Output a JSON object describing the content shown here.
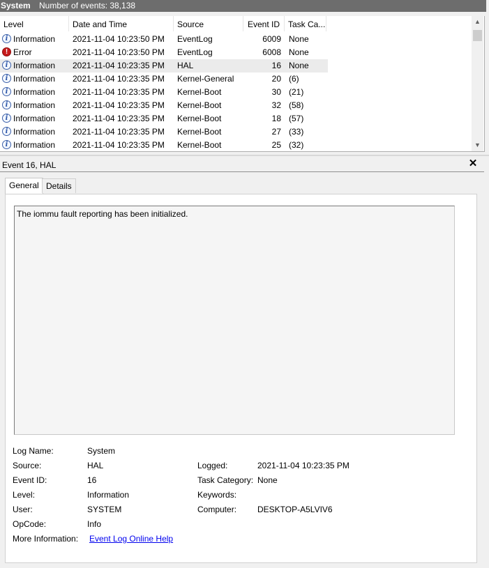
{
  "title_bar": {
    "log": "System",
    "events": "Number of events: 38,138"
  },
  "columns": [
    "Level",
    "Date and Time",
    "Source",
    "Event ID",
    "Task Ca..."
  ],
  "events": [
    {
      "level": "Information",
      "icon": "info-icon",
      "date": "2021-11-04 10:23:50 PM",
      "source": "EventLog",
      "id": "6009",
      "task": "None"
    },
    {
      "level": "Error",
      "icon": "error-icon",
      "date": "2021-11-04 10:23:50 PM",
      "source": "EventLog",
      "id": "6008",
      "task": "None"
    },
    {
      "level": "Information",
      "icon": "info-icon",
      "date": "2021-11-04 10:23:35 PM",
      "source": "HAL",
      "id": "16",
      "task": "None"
    },
    {
      "level": "Information",
      "icon": "info-icon",
      "date": "2021-11-04 10:23:35 PM",
      "source": "Kernel-General",
      "id": "20",
      "task": "(6)"
    },
    {
      "level": "Information",
      "icon": "info-icon",
      "date": "2021-11-04 10:23:35 PM",
      "source": "Kernel-Boot",
      "id": "30",
      "task": "(21)"
    },
    {
      "level": "Information",
      "icon": "info-icon",
      "date": "2021-11-04 10:23:35 PM",
      "source": "Kernel-Boot",
      "id": "32",
      "task": "(58)"
    },
    {
      "level": "Information",
      "icon": "info-icon",
      "date": "2021-11-04 10:23:35 PM",
      "source": "Kernel-Boot",
      "id": "18",
      "task": "(57)"
    },
    {
      "level": "Information",
      "icon": "info-icon",
      "date": "2021-11-04 10:23:35 PM",
      "source": "Kernel-Boot",
      "id": "27",
      "task": "(33)"
    },
    {
      "level": "Information",
      "icon": "info-icon",
      "date": "2021-11-04 10:23:35 PM",
      "source": "Kernel-Boot",
      "id": "25",
      "task": "(32)"
    }
  ],
  "detail": {
    "title": "Event 16, HAL",
    "tabs": [
      "General",
      "Details"
    ],
    "description": "The iommu fault reporting has been initialized.",
    "labels": {
      "log_name": "Log Name:",
      "source": "Source:",
      "event_id": "Event ID:",
      "level": "Level:",
      "user": "User:",
      "opcode": "OpCode:",
      "more_info": "More Information:",
      "logged": "Logged:",
      "task_category": "Task Category:",
      "keywords": "Keywords:",
      "computer": "Computer:"
    },
    "values": {
      "log_name": "System",
      "source": "HAL",
      "event_id": "16",
      "level": "Information",
      "user": "SYSTEM",
      "opcode": "Info",
      "more_info_link": "Event Log Online Help",
      "logged": "2021-11-04 10:23:35 PM",
      "task_category": "None",
      "keywords": "",
      "computer": "DESKTOP-A5LVIV6"
    }
  }
}
